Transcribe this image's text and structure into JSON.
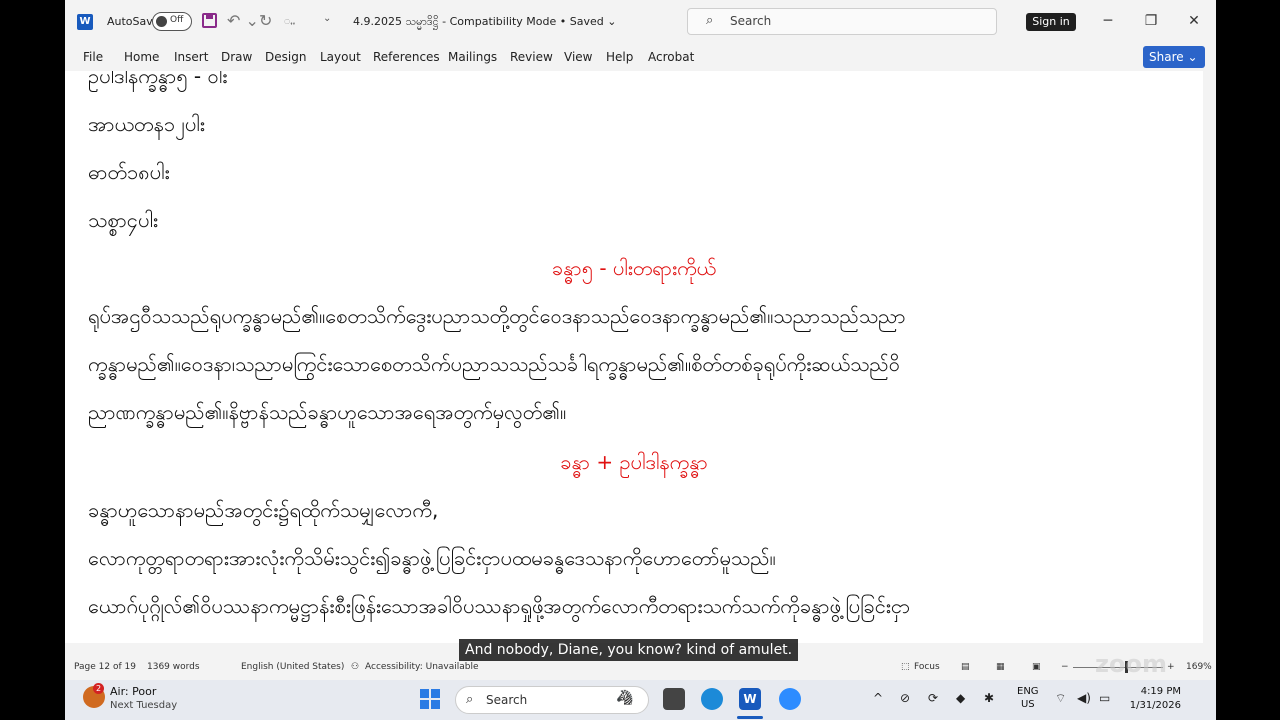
{
  "titlebar": {
    "app_icon": "word-icon",
    "autosave_label": "AutoSave",
    "autosave_state": "Off",
    "qat_extra": "ꩻꩻ",
    "document_title": "4.9.2025 သမ္မာဒိဋ္ဌိ - Compatibility Mode • Saved ⌄",
    "search_placeholder": "Search",
    "signin_label": "Sign in",
    "minimize": "─",
    "maximize": "❐",
    "close": "✕"
  },
  "ribbon": {
    "tabs": [
      "File",
      "Home",
      "Insert",
      "Draw",
      "Design",
      "Layout",
      "References",
      "Mailings",
      "Review",
      "View",
      "Help",
      "Acrobat"
    ],
    "share_label": "Share ⌄"
  },
  "document": {
    "lines": [
      "ဥပါဒါနက္ခန္ဓာ၅ - ၀ါး",
      "အာယတန၁၂ပါး",
      "ဓာတ်၁၈ပါး",
      "သစ္စာ၄ပါး"
    ],
    "heading1": "ခန္ဓာ၅ - ပါးတရားကိုယ်",
    "paragraph1": [
      "ရုပ်အဌဝီသသည်ရုပက္ခန္ဓာမည်၏။စေတသိက်ဒွေးပညာသတို့တွင်ဝေဒနာသည်ဝေဒနာက္ခန္ဓာမည်၏။သညာသည်သညာ",
      "က္ခန္ဓာမည်၏။ဝေဒနာ၊သညာမကြွင်းသောစေတသိက်ပညာသသည်သင်္ခါရက္ခန္ဓာမည်၏။စိတ်တစ်ခုရုပ်ကိုးဆယ်သည်ဝိ",
      "ညာဏက္ခန္ဓာမည်၏။နိဗ္ဗာန်သည်ခန္ဓာဟူသောအရေအတွက်မှလွတ်၏။"
    ],
    "heading2": "ခန္ဓာ + ဥပါဒါနက္ခန္ဓာ",
    "paragraph2": [
      "ခန္ဓာဟူသောနာမည်အတွင်း၌ရထိုက်သမျှလောကီ,",
      "လောကုတ္တရာတရားအားလုံးကိုသိမ်းသွင်း၍ခန္ဓာဖွဲ့ပြခြင်းငှာပထမခန္ဓဒေသနာကိုဟောတော်မူသည်။",
      "ယောဂ်ပုဂ္ဂိုလ်၏ဝိပဿနာကမ္မဋ္ဌာန်းစီးဖြန်းသောအခါဝိပဿနာရှုဖို့အတွက်လောကီတရားသက်သက်ကိုခန္ဓာဖွဲ့ပြခြင်းငှာ"
    ]
  },
  "caption": "And nobody, Diane, you know? kind of amulet.",
  "statusbar": {
    "page": "Page 12 of 19",
    "words": "1369 words",
    "language": "English (United States)",
    "accessibility": "Accessibility: Unavailable",
    "focus": "Focus",
    "zoom": "169%",
    "watermark": "zoom"
  },
  "taskbar": {
    "weather_badge": "2",
    "weather_status": "Air: Poor",
    "weather_sub": "Next Tuesday",
    "search_placeholder": "Search",
    "lang_line1": "ENG",
    "lang_line2": "US",
    "time": "4:19 PM",
    "date": "1/31/2026"
  }
}
